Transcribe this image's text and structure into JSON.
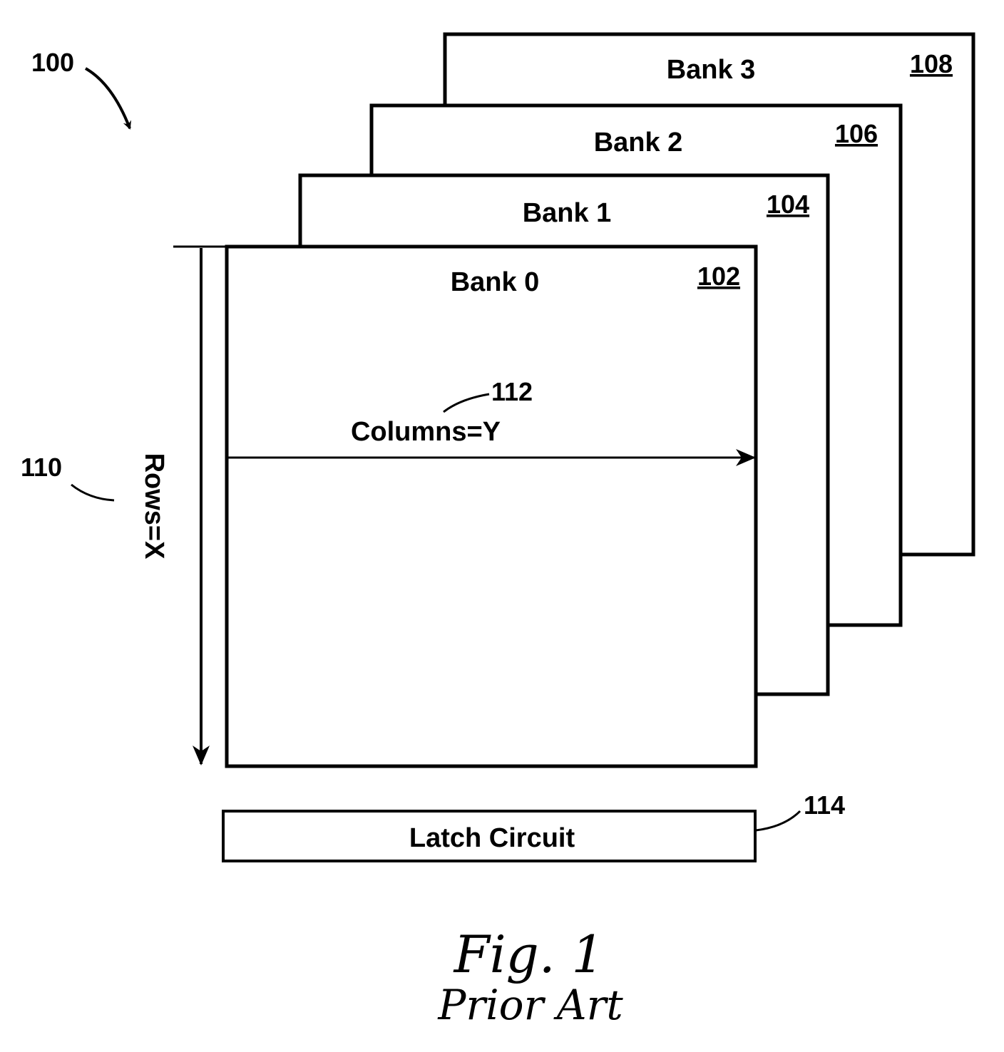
{
  "figure": {
    "ref": "100",
    "caption": "Fig. 1",
    "subcaption": "Prior Art"
  },
  "banks": [
    {
      "label": "Bank 0",
      "ref": "102"
    },
    {
      "label": "Bank 1",
      "ref": "104"
    },
    {
      "label": "Bank 2",
      "ref": "106"
    },
    {
      "label": "Bank 3",
      "ref": "108"
    }
  ],
  "rows": {
    "label": "Rows=X",
    "ref": "110"
  },
  "columns": {
    "label": "Columns=Y",
    "ref": "112"
  },
  "latch": {
    "label": "Latch Circuit",
    "ref": "114"
  }
}
